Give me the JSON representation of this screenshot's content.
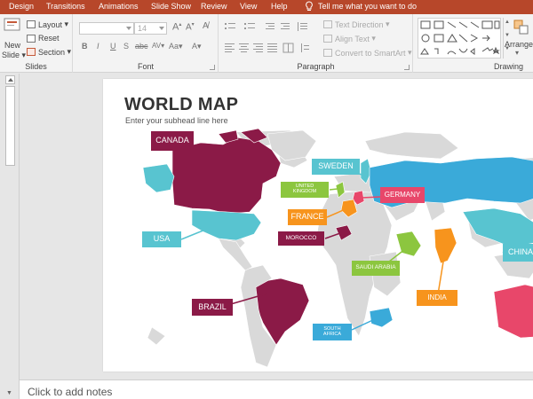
{
  "tabs": [
    "Design",
    "Transitions",
    "Animations",
    "Slide Show",
    "Review",
    "View",
    "Help"
  ],
  "tell_me": "Tell me what you want to do",
  "ribbon": {
    "slides": {
      "new_slide_line1": "New",
      "new_slide_line2": "Slide",
      "layout": "Layout",
      "reset": "Reset",
      "section": "Section",
      "label": "Slides"
    },
    "font": {
      "size_value": "14",
      "label": "Font",
      "bold": "B",
      "italic": "I",
      "underline": "U",
      "strike": "S",
      "abc": "abc",
      "aa": "Aa",
      "a": "A"
    },
    "paragraph": {
      "text_direction": "Text Direction",
      "align_text": "Align Text",
      "convert_smartart": "Convert to SmartArt",
      "label": "Paragraph"
    },
    "drawing": {
      "arrange": "Arrange",
      "label": "Drawing"
    }
  },
  "slide": {
    "title": "WORLD MAP",
    "subhead": "Enter your subhead line here",
    "labels": {
      "canada": "CANADA",
      "sweden": "SWEDEN",
      "united_kingdom_1": "UNITED",
      "united_kingdom_2": "KINGDOM",
      "germany": "GERMANY",
      "france": "FRANCE",
      "usa": "USA",
      "morocco": "MOROCCO",
      "china": "CHINA",
      "saudi_arabia": "SAUDI ARABIA",
      "brazil": "BRAZIL",
      "india": "INDIA",
      "south_africa_1": "SOUTH",
      "south_africa_2": "AFRICA"
    }
  },
  "notes_placeholder": "Click to add notes",
  "colors": {
    "tab_bar": "#b7472a",
    "maroon": "#8b1a47",
    "blue": "#3aaad9",
    "teal": "#58c4d0",
    "green": "#8cc63f",
    "orange": "#f7941d",
    "pink": "#e8476a",
    "gray": "#d9d9d9"
  }
}
